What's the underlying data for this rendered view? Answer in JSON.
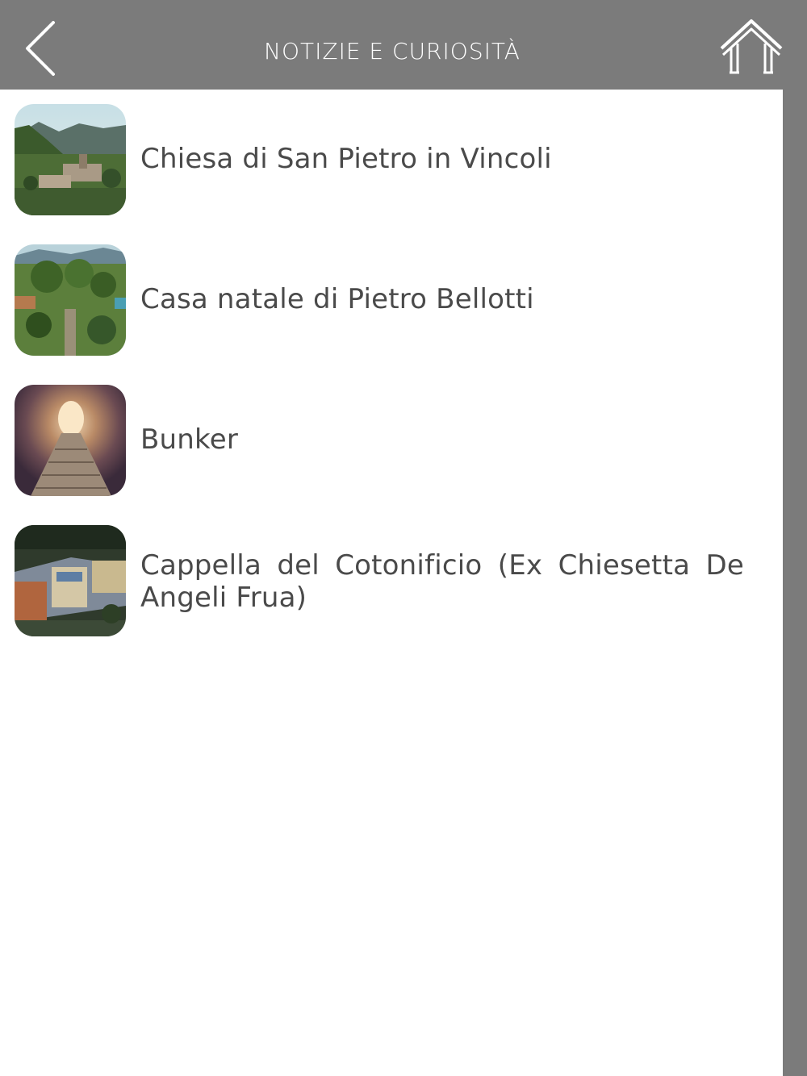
{
  "header": {
    "title": "NOTIZIE E CURIOSITÀ",
    "back_icon": "chevron-left-icon",
    "home_icon": "home-icon"
  },
  "colors": {
    "header_bg": "#7b7b7b",
    "content_bg": "#ffffff",
    "text": "#4a4a4a",
    "header_text": "#ffffff"
  },
  "items": [
    {
      "label": "Chiesa di San Pietro in Vincoli",
      "thumbnail": "mountain-valley-village-photo"
    },
    {
      "label": "Casa natale di Pietro Bellotti",
      "thumbnail": "green-hills-estate-photo"
    },
    {
      "label": "Bunker",
      "thumbnail": "tunnel-stairs-photo"
    },
    {
      "label": "Cappella del Cotonificio (Ex Chiesetta De Angeli Frua)",
      "thumbnail": "factory-aerial-photo"
    }
  ]
}
